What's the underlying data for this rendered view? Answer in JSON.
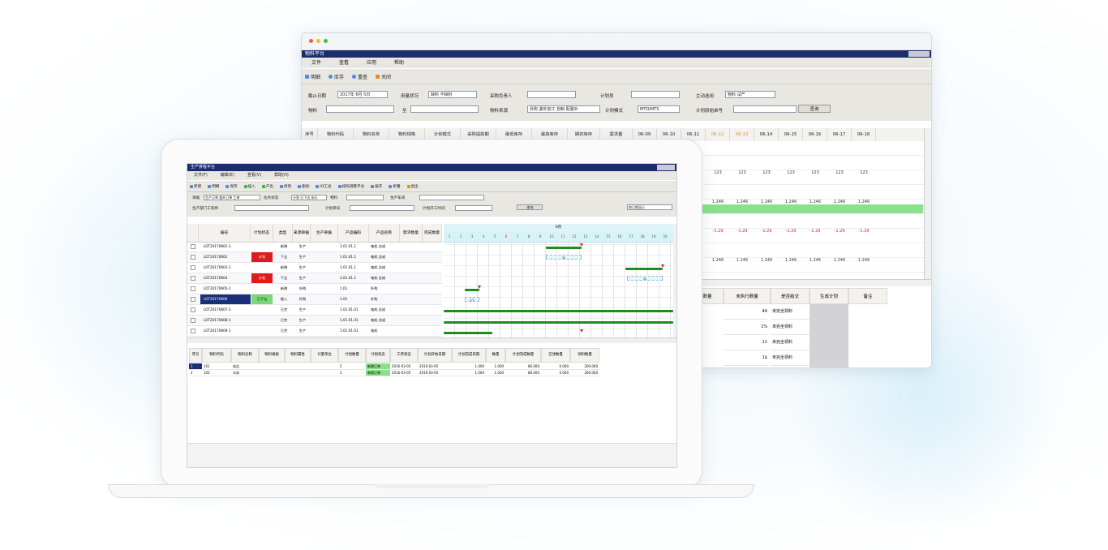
{
  "back_window": {
    "title": "物料平台",
    "menu": [
      "文件",
      "查看",
      "应用",
      "帮助"
    ],
    "toolbar": [
      {
        "label": "明细",
        "icon": "detail-icon",
        "color": "#4a8fd8"
      },
      {
        "label": "库存",
        "icon": "stock-icon",
        "color": "#4a8fd8"
      },
      {
        "label": "重查",
        "icon": "refresh-icon",
        "color": "#4a8fd8"
      },
      {
        "label": "关闭",
        "icon": "close-icon",
        "color": "#e58c1a"
      }
    ],
    "filters": {
      "deadline_label": "截止日期",
      "deadline_value": "2017年 6月 5日",
      "status_label": "用量状况",
      "status_value": "缺料 不缺料",
      "purchaser_label": "采购负责人",
      "planner_label": "计划员",
      "category_label": "主动选用",
      "category_value": "物料 试产",
      "material_label": "物料",
      "to_label": "至",
      "source_label": "物料来源",
      "source_value": "外购 委外加工 自制 配置外",
      "plan_mode_label": "计划模式",
      "plan_mode_value": "MTO/MTS",
      "plan_source_label": "计划原始单号",
      "query_button": "查询"
    },
    "grid_headers": [
      "序号",
      "物料代码",
      "物料名称",
      "物料规格",
      "计划模式",
      "采购提前期",
      "最低库存",
      "最高库存",
      "期初库存",
      "需求量",
      "06-09",
      "06-10",
      "06-11",
      "06-12",
      "06-13",
      "06-14",
      "06-15",
      "06-16",
      "06-17",
      "06-18"
    ],
    "grid_values": [
      "123",
      "1.246",
      "-1.29",
      "1.246"
    ],
    "sub_headers": [
      "数量",
      "未执行数量",
      "是否结交",
      "生成计划",
      "备注"
    ],
    "sub_rows": [
      {
        "qty": "44",
        "status": "未完全领料"
      },
      {
        "qty": "1%",
        "status": "未完全领料"
      },
      {
        "qty": "11",
        "status": "未完全领料"
      },
      {
        "qty": "1$",
        "status": "未完全领料"
      }
    ]
  },
  "laptop_window": {
    "title": "生产排程平台",
    "menu": [
      "文件(F)",
      "编辑(E)",
      "查看(V)",
      "帮助(H)"
    ],
    "toolbar": [
      "新建",
      "明细",
      "保存",
      "插入",
      "产出",
      "修改",
      "删除",
      "IO汇总",
      "按照调整平台",
      "展开",
      "折叠",
      "退出"
    ],
    "filters": {
      "order_label": "单据",
      "order_value": "生产订单 委外订单 工单",
      "status_label": "任务状态",
      "status_value": "计划 已下达 执行",
      "item_label": "物料",
      "line_label": "生产车间",
      "dept_label": "生产部门工程师",
      "plan_no_label": "计划单号",
      "plan_time_label": "计划开工时间",
      "query_button": "查询",
      "view_select": "按日期显示"
    },
    "left_headers": [
      "",
      "编号",
      "计划状态",
      "类型",
      "来源单据",
      "生产单据",
      "产品编码",
      "产品名称",
      "需求数量",
      "完成数量"
    ],
    "left_rows": [
      {
        "code": "LOT20170601-1",
        "state": "",
        "state_color": "",
        "type": "新增",
        "src": "生产",
        "pcode": "1.01.01.1",
        "pname": "电机 总成"
      },
      {
        "code": "LOT20170602",
        "state": "计划",
        "state_color": "#e11b1b",
        "type": "下达",
        "src": "生产",
        "pcode": "1.01.01.1",
        "pname": "电机 总成"
      },
      {
        "code": "LOT20170603-1",
        "state": "",
        "state_color": "",
        "type": "新增",
        "src": "生产",
        "pcode": "1.01.01.1",
        "pname": "电机 总成"
      },
      {
        "code": "LOT20170604",
        "state": "计划",
        "state_color": "#e11b1b",
        "type": "下达",
        "src": "生产",
        "pcode": "1.01.01.1",
        "pname": "电机 总成"
      },
      {
        "code": "LOT20170605-1",
        "state": "",
        "state_color": "",
        "type": "新增",
        "src": "外购",
        "pcode": "1.01",
        "pname": "外购"
      },
      {
        "code": "LOT20170606",
        "state": "已下达",
        "state_color": "#79d879",
        "type": "插入",
        "src": "外购",
        "pcode": "1.01",
        "pname": "外购"
      },
      {
        "code": "LOT20170607-1",
        "state": "",
        "state_color": "",
        "type": "已完",
        "src": "生产",
        "pcode": "1.01.01.01",
        "pname": "电机 总成"
      },
      {
        "code": "LOT20170608-1",
        "state": "",
        "state_color": "",
        "type": "已完",
        "src": "生产",
        "pcode": "1.01.01.01",
        "pname": "电机 总成"
      },
      {
        "code": "LOT20170609-1",
        "state": "",
        "state_color": "",
        "type": "已完",
        "src": "生产",
        "pcode": "1.01.01.01",
        "pname": "电机"
      }
    ],
    "gantt_month": "6月",
    "gantt_days": [
      "1",
      "2",
      "3",
      "4",
      "5",
      "6",
      "7",
      "8",
      "9",
      "10",
      "11",
      "12",
      "13",
      "14",
      "15",
      "16",
      "17",
      "18",
      "19",
      "20"
    ],
    "gantt_labels": [
      "30",
      "30",
      "1/1"
    ],
    "detail_headers": [
      "序号",
      "物料代码",
      "物料名称",
      "物料规格",
      "物料属性",
      "计量单位",
      "计划数量",
      "计划状态",
      "工序状态",
      "计划开始日期",
      "计划完成日期",
      "数量",
      "计划完成数量",
      "已领数量",
      "领料数量"
    ],
    "detail_rows": [
      {
        "no": "1",
        "code": "101",
        "name": "成品",
        "qty": "5",
        "state": "新增订单",
        "start": "2016-03-05",
        "end": "2016-03-05",
        "n1": "1.000",
        "n2": "1.000",
        "n3": "86.000",
        "n4": "0.000",
        "n5": "200.000"
      },
      {
        "no": "2",
        "code": "102",
        "name": "半成",
        "qty": "5",
        "state": "新增订单",
        "start": "2016-03-05",
        "end": "2016-03-05",
        "n1": "1.000",
        "n2": "1.000",
        "n3": "86.000",
        "n4": "0.000",
        "n5": "200.000"
      }
    ],
    "state_green": "#8be08b",
    "select_blue": "#1a2f7a"
  }
}
